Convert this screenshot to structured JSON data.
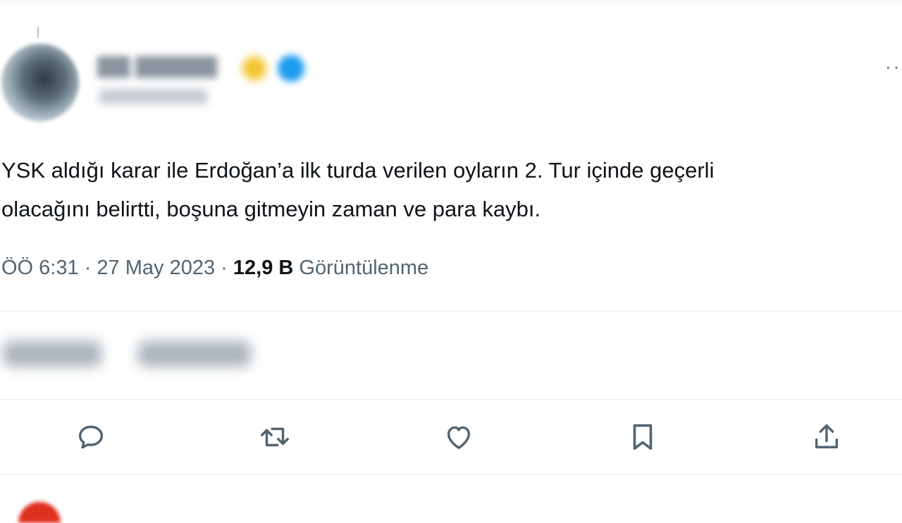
{
  "tweet": {
    "text_lines": [
      "YSK aldığı karar ile Erdoğan’a ilk turda verilen oyların 2. Tur içinde geçerli",
      "olacağını belirtti, boşuna gitmeyin zaman ve para kaybı."
    ],
    "time": "ÖÖ 6:31",
    "separator": "·",
    "date": "27 May 2023",
    "views_count": "12,9 B",
    "views_label": "Görüntülenme"
  },
  "more_menu": {
    "icon": "more-horizontal-icon",
    "glyph": "··"
  },
  "actions": [
    {
      "name": "reply",
      "icon": "reply-icon"
    },
    {
      "name": "retweet",
      "icon": "retweet-icon"
    },
    {
      "name": "like",
      "icon": "heart-icon"
    },
    {
      "name": "bookmark",
      "icon": "bookmark-icon"
    },
    {
      "name": "share",
      "icon": "share-icon"
    }
  ],
  "colors": {
    "text": "#0f1419",
    "secondary_text": "#536471",
    "divider": "#e6e9eb",
    "verified_blue": "#1d9bf0"
  }
}
